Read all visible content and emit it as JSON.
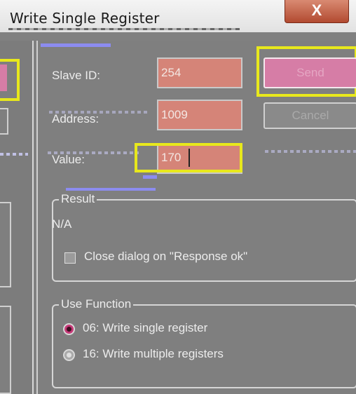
{
  "window": {
    "title": "Write Single Register",
    "close_glyph": "X"
  },
  "form": {
    "slave_id_label": "Slave ID:",
    "slave_id_value": "254",
    "address_label": "Address:",
    "address_value": "1009",
    "value_label": "Value:",
    "value_value": "170"
  },
  "buttons": {
    "send_label": "Send",
    "cancel_label": "Cancel"
  },
  "result": {
    "legend": "Result",
    "text": "N/A",
    "close_on_ok_label": "Close dialog on \"Response ok\"",
    "close_on_ok_checked": false
  },
  "function": {
    "legend": "Use Function",
    "options": [
      {
        "label": "06: Write single register",
        "selected": true
      },
      {
        "label": "16: Write multiple registers",
        "selected": false
      }
    ]
  },
  "colors": {
    "highlight": "#e8e81c",
    "field_bg": "#d58478",
    "send_bg": "#d67da6",
    "dialog_bg": "#7f7f7f"
  }
}
